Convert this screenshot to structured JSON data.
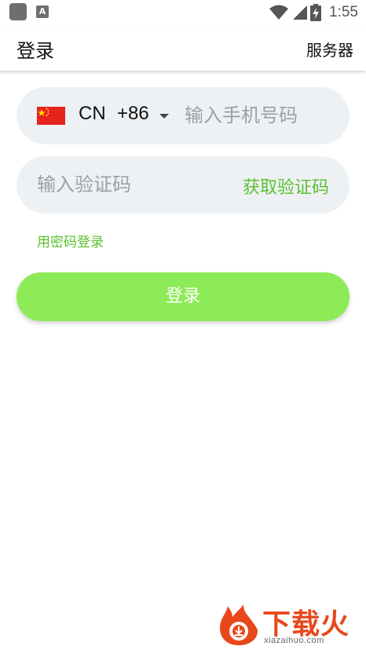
{
  "status_bar": {
    "time": "1:55",
    "icons": [
      "app-icon",
      "a-notification-icon",
      "wifi-icon",
      "signal-icon",
      "battery-charging-icon"
    ],
    "a_glyph": "A"
  },
  "header": {
    "title": "登录",
    "server_label": "服务器"
  },
  "phone": {
    "country_code": "CN",
    "dial_code": "+86",
    "placeholder": "输入手机号码",
    "value": ""
  },
  "verification": {
    "placeholder": "输入验证码",
    "value": "",
    "get_code_label": "获取验证码"
  },
  "password_login_link": "用密码登录",
  "login_button": "登录",
  "watermark": {
    "brand": "下载火",
    "url": "xiazaihuo.com"
  },
  "colors": {
    "accent_green": "#5ac12f",
    "button_green": "#8eeb58",
    "field_bg": "#eef1f4",
    "watermark_orange": "#e8481b"
  }
}
